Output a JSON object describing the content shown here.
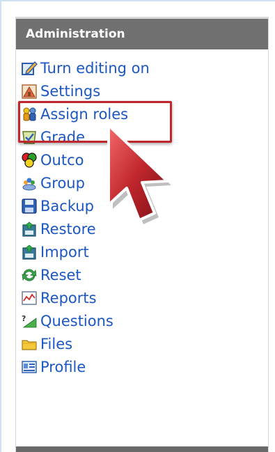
{
  "block": {
    "title": "Administration",
    "items": [
      {
        "label": "Turn editing on",
        "icon": "edit-pencil-icon"
      },
      {
        "label": "Settings",
        "icon": "settings-icon"
      },
      {
        "label": "Assign roles",
        "icon": "roles-icon"
      },
      {
        "label": "Grade",
        "icon": "grades-icon"
      },
      {
        "label": "Outco",
        "icon": "outcomes-icon"
      },
      {
        "label": "Group",
        "icon": "groups-icon"
      },
      {
        "label": "Backup",
        "icon": "backup-icon"
      },
      {
        "label": "Restore",
        "icon": "restore-icon"
      },
      {
        "label": "Import",
        "icon": "import-icon"
      },
      {
        "label": "Reset",
        "icon": "reset-icon"
      },
      {
        "label": "Reports",
        "icon": "reports-icon"
      },
      {
        "label": "Questions",
        "icon": "questions-icon"
      },
      {
        "label": "Files",
        "icon": "files-icon"
      },
      {
        "label": "Profile",
        "icon": "profile-icon"
      }
    ]
  },
  "colors": {
    "link": "#1b57c2",
    "header_bg": "#707070",
    "highlight": "#c0272d",
    "cursor": "#c0272d"
  }
}
